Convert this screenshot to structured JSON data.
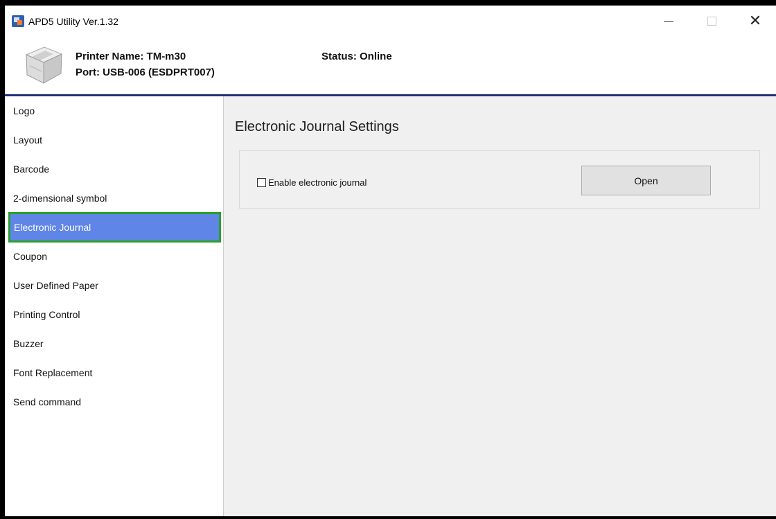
{
  "window": {
    "title": "APD5 Utility Ver.1.32",
    "controls": {
      "minimize": "—",
      "maximize": "☐",
      "close": "✕"
    }
  },
  "header": {
    "printer_name": "Printer Name: TM-m30",
    "port": "Port: USB-006 (ESDPRT007)",
    "status": "Status: Online"
  },
  "sidebar": {
    "items": [
      {
        "label": "Logo"
      },
      {
        "label": "Layout"
      },
      {
        "label": "Barcode"
      },
      {
        "label": "2-dimensional symbol"
      },
      {
        "label": "Electronic Journal",
        "selected": true
      },
      {
        "label": "Coupon"
      },
      {
        "label": "User Defined Paper"
      },
      {
        "label": "Printing Control"
      },
      {
        "label": "Buzzer"
      },
      {
        "label": "Font Replacement"
      },
      {
        "label": "Send command"
      }
    ]
  },
  "main": {
    "title": "Electronic Journal Settings",
    "checkbox_label": "Enable electronic journal",
    "checkbox_checked": false,
    "open_button": "Open"
  },
  "colors": {
    "header_border": "#223073",
    "selected_bg": "#5f85e6",
    "selected_outline": "#2aa02a",
    "main_bg": "#f0f0f0"
  }
}
